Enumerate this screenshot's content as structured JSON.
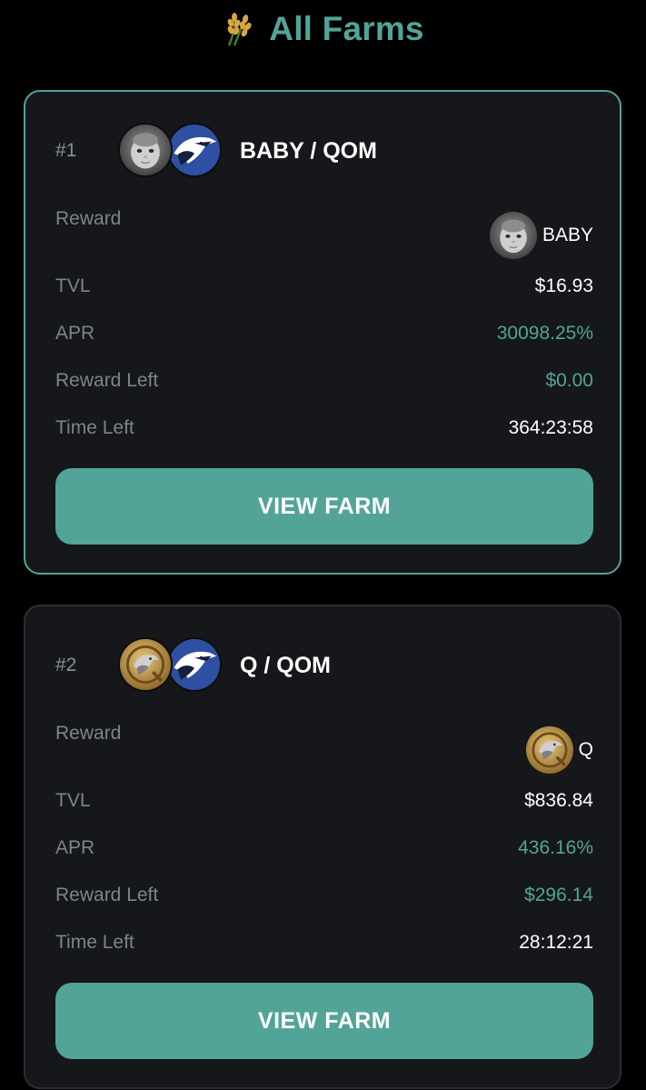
{
  "header": {
    "title": "All Farms",
    "icon": "rice-stalk-icon"
  },
  "colors": {
    "accent": "#52a498",
    "card_bg": "#15171b",
    "muted_text": "#7e838c",
    "page_bg": "#000000"
  },
  "labels": {
    "reward": "Reward",
    "tvl": "TVL",
    "apr": "APR",
    "reward_left": "Reward Left",
    "time_left": "Time Left",
    "view_farm": "VIEW FARM"
  },
  "farms": [
    {
      "rank": "#1",
      "pair": "BABY / QOM",
      "token_icons": [
        "baby-token-icon",
        "qom-eagle-token-icon"
      ],
      "reward_token": "BABY",
      "reward_icon": "baby-token-icon",
      "tvl": "$16.93",
      "apr": "30098.25%",
      "reward_left": "$0.00",
      "time_left": "364:23:58",
      "selected": true
    },
    {
      "rank": "#2",
      "pair": "Q / QOM",
      "token_icons": [
        "q-eagle-coin-icon",
        "qom-eagle-token-icon"
      ],
      "reward_token": "Q",
      "reward_icon": "q-eagle-coin-icon",
      "tvl": "$836.84",
      "apr": "436.16%",
      "reward_left": "$296.14",
      "time_left": "28:12:21",
      "selected": false
    }
  ]
}
